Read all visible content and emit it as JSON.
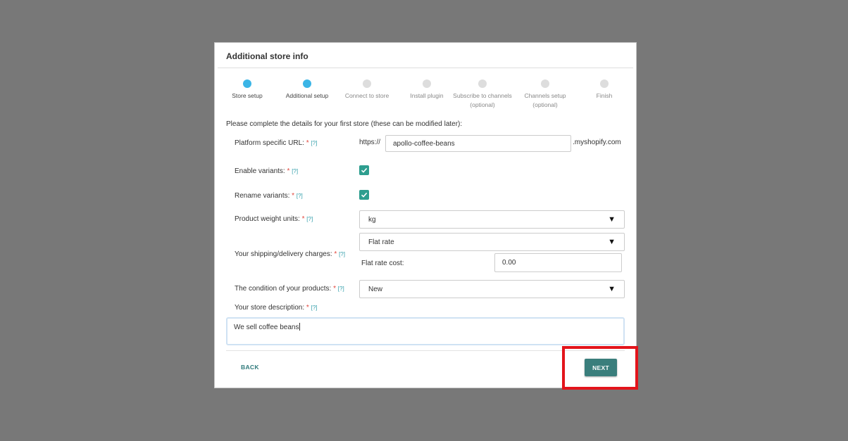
{
  "modal": {
    "title": "Additional store info",
    "intro": "Please complete the details for your first store (these can be modified later):"
  },
  "steps": [
    {
      "label": "Store setup",
      "state": "completed"
    },
    {
      "label": "Additional setup",
      "state": "active"
    },
    {
      "label": "Connect to store",
      "state": "pending"
    },
    {
      "label": "Install plugin",
      "state": "pending"
    },
    {
      "label": "Subscribe to channels (optional)",
      "state": "pending"
    },
    {
      "label": "Channels setup (optional)",
      "state": "pending"
    },
    {
      "label": "Finish",
      "state": "pending"
    }
  ],
  "fields": {
    "required_mark": "*",
    "help_mark": "[?]",
    "platform_url": {
      "label": "Platform specific URL:",
      "prefix": "https://",
      "value": "apollo-coffee-beans",
      "suffix": ".myshopify.com"
    },
    "enable_variants": {
      "label": "Enable variants:",
      "checked": true
    },
    "rename_variants": {
      "label": "Rename variants:",
      "checked": true
    },
    "weight_units": {
      "label": "Product weight units:",
      "value": "kg"
    },
    "shipping": {
      "label": "Your shipping/delivery charges:",
      "value": "Flat rate",
      "cost_label": "Flat rate cost:",
      "cost_value": "0.00"
    },
    "condition": {
      "label": "The condition of your products:",
      "value": "New"
    },
    "description": {
      "label": "Your store description:",
      "value": "We sell coffee beans"
    }
  },
  "buttons": {
    "back": "BACK",
    "next": "NEXT"
  },
  "colors": {
    "overlay": "#787878",
    "step_active": "#3bb5e6",
    "step_pending": "#dddddd",
    "checkbox": "#2e9e8f",
    "primary_button": "#3a7e7c",
    "highlight": "#e3141b"
  }
}
